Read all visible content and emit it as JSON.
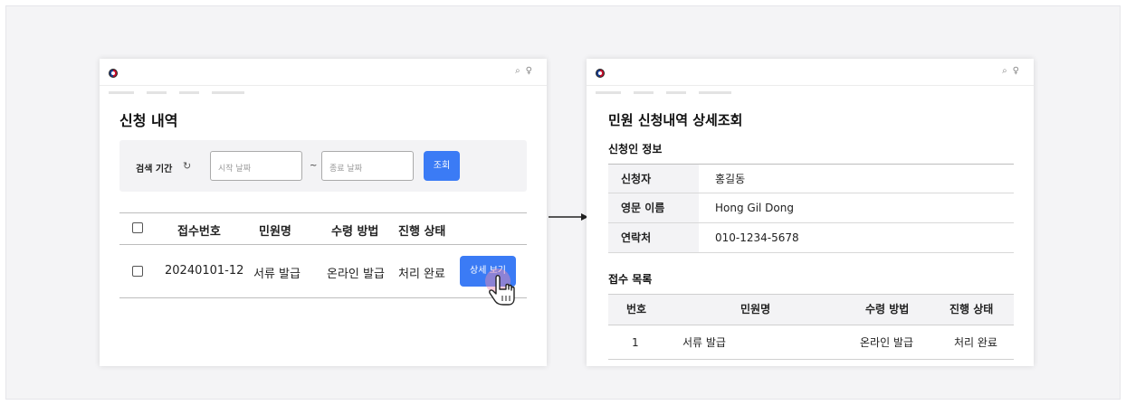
{
  "left_screen": {
    "page_title": "신청 내역",
    "search": {
      "label": "검색 기간",
      "start_placeholder": "시작 날짜",
      "separator": "~",
      "end_placeholder": "종료 날짜",
      "query_label": "조회"
    },
    "table": {
      "headers": [
        "접수번호",
        "민원명",
        "수령 방법",
        "진행 상태"
      ],
      "rows": [
        {
          "receipt_no": "20240101-12",
          "name": "서류 발급",
          "method": "온라인 발급",
          "status": "처리 완료",
          "action": "상세 보기"
        }
      ]
    }
  },
  "right_screen": {
    "page_title": "민원 신청내역 상세조회",
    "applicant_section": "신청인 정보",
    "applicant": [
      {
        "key": "신청자",
        "value": "홍길동"
      },
      {
        "key": "영문 이름",
        "value": "Hong Gil Dong"
      },
      {
        "key": "연락처",
        "value": "010-1234-5678"
      }
    ],
    "receipt_section": "접수 목록",
    "receipt_headers": [
      "번호",
      "민원명",
      "수령 방법",
      "진행 상태"
    ],
    "receipt_rows": [
      {
        "no": "1",
        "name": "서류 발급",
        "method": "온라인 발급",
        "status": "처리 완료"
      }
    ]
  },
  "icons": {
    "search": "search-icon",
    "user": "user-icon",
    "refresh": "refresh-icon",
    "cursor": "hand-pointer-icon",
    "arrow": "arrow-right-icon"
  },
  "colors": {
    "accent": "#3b7bf5",
    "table_header_bg": "#f3f3f5",
    "canvas_bg": "#f4f4f6"
  }
}
